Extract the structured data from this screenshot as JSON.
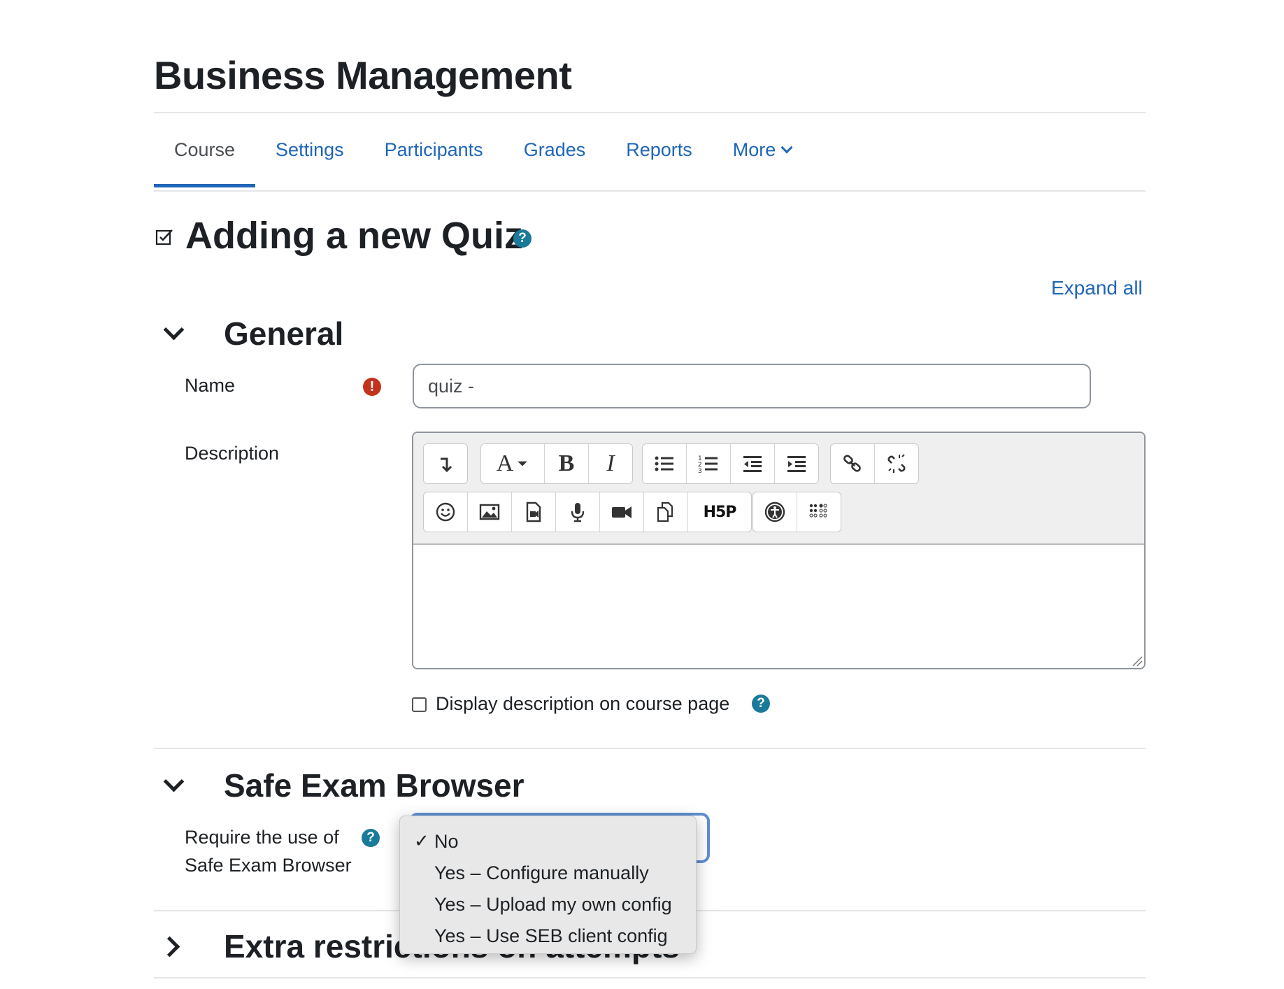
{
  "course": {
    "title": "Business Management"
  },
  "nav": {
    "tabs": [
      {
        "label": "Course",
        "active": true
      },
      {
        "label": "Settings"
      },
      {
        "label": "Participants"
      },
      {
        "label": "Grades"
      },
      {
        "label": "Reports"
      },
      {
        "label": "More"
      }
    ]
  },
  "page": {
    "heading": "Adding a new Quiz",
    "heading_icon": "checkbox-square-icon",
    "expand_all": "Expand all"
  },
  "sections": {
    "general": {
      "title": "General",
      "expanded": true,
      "name_label": "Name",
      "name_value": "quiz -",
      "description_label": "Description",
      "display_description_label": "Display description on course page",
      "display_description_checked": false
    },
    "seb": {
      "title": "Safe Exam Browser",
      "expanded": true,
      "require_label_line1": "Require the use of",
      "require_label_line2": "Safe Exam Browser",
      "selected": "No",
      "options": [
        "No",
        "Yes – Configure manually",
        "Yes – Upload my own config",
        "Yes – Use SEB client config"
      ]
    },
    "extra": {
      "title": "Extra restrictions on attempts",
      "expanded": false
    }
  },
  "editor_toolbar": {
    "row1": [
      [
        "collapse-icon"
      ],
      [
        "font-style-icon",
        "bold-icon",
        "italic-icon"
      ],
      [
        "unordered-list-icon",
        "ordered-list-icon",
        "outdent-icon",
        "indent-icon"
      ],
      [
        "link-icon",
        "unlink-icon"
      ]
    ],
    "row2": [
      [
        "emoji-icon",
        "image-icon",
        "media-icon",
        "record-audio-icon",
        "record-video-icon",
        "manage-files-icon",
        "h5p-icon"
      ],
      [
        "accessibility-checker-icon",
        "screenreader-helper-icon"
      ]
    ],
    "h5p_text": "H5P"
  },
  "colors": {
    "link": "#1f66b8",
    "text": "#1d2125",
    "help": "#1a7a99",
    "required": "#c4311c",
    "focus": "#5e8fd0"
  }
}
